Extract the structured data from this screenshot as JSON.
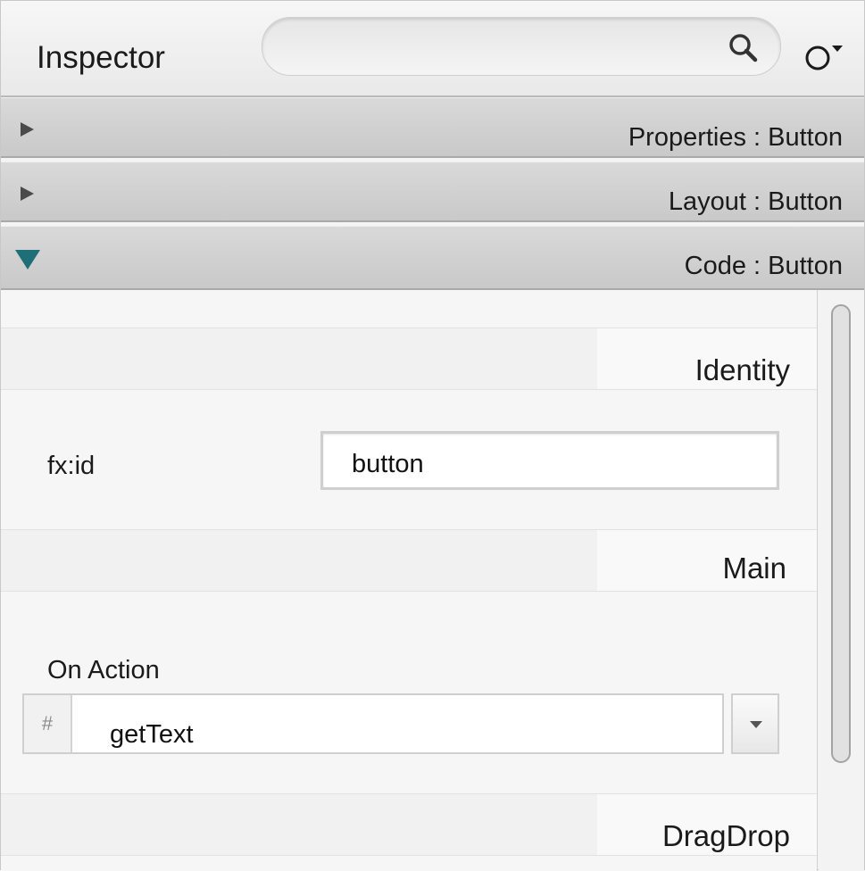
{
  "header": {
    "title": "Inspector",
    "search": {
      "value": "",
      "placeholder": "",
      "icon": "search-icon"
    },
    "settings": {
      "label": "O▾",
      "icon": "settings-icon"
    }
  },
  "sections": [
    {
      "label": "Properties : Button",
      "expanded": false
    },
    {
      "label": "Layout : Button",
      "expanded": false
    },
    {
      "label": "Code : Button",
      "expanded": true
    }
  ],
  "code": {
    "groups": {
      "identity": "Identity",
      "main": "Main",
      "dragdrop": "DragDrop"
    },
    "fx_id": {
      "label": "fx:id",
      "value": "button"
    },
    "on_action": {
      "label": "On Action",
      "prefix": "#",
      "value": "getText"
    }
  },
  "colors": {
    "expanded_triangle": "#1f6f78",
    "collapsed_triangle": "#4a4a4a"
  }
}
